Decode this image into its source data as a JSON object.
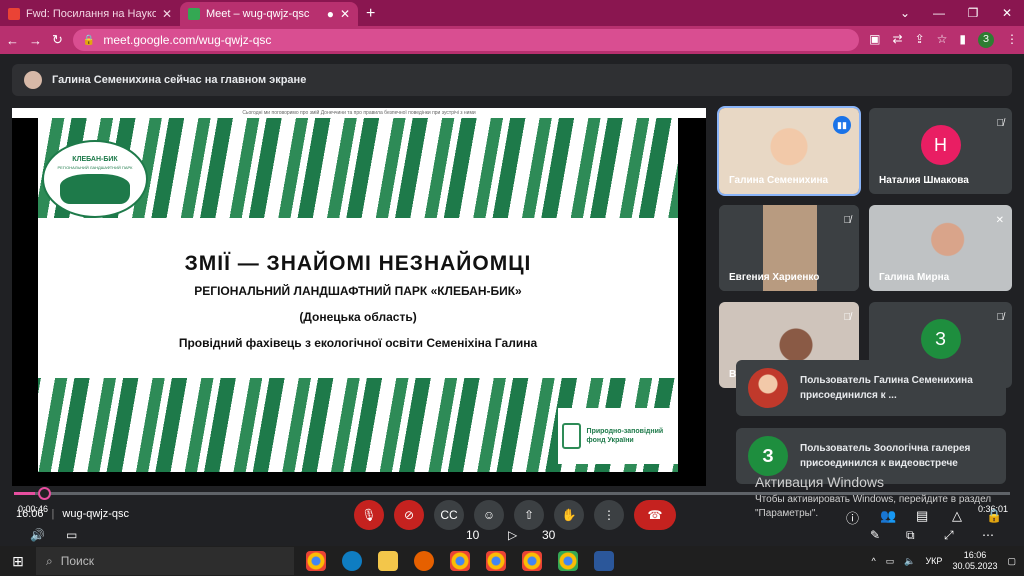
{
  "browser": {
    "tabs": [
      {
        "title": "Fwd: Посилання на Науковий п...",
        "active": false
      },
      {
        "title": "Meet – wug-qwjz-qsc",
        "active": true
      }
    ],
    "new_tab": "+",
    "url": "meet.google.com/wug-qwjz-qsc",
    "profile_initial": "З"
  },
  "meet": {
    "banner_text": "Галина Семенихина сейчас на главном экране",
    "meeting_code": "wug-qwjz-qsc",
    "clock": "16:06"
  },
  "slide": {
    "header_strip": "Сьогодні ми поговоримо про змій Донеччини та про правила безпечної поведінки при зустрічі з ними",
    "logo_title": "КЛЕБАН-БИК",
    "logo_sub": "РЕГІОНАЛЬНИЙ ЛАНДШАФТНИЙ ПАРК",
    "title": "ЗМІЇ — ЗНАЙОМІ НЕЗНАЙОМЦІ",
    "line1": "РЕГІОНАЛЬНИЙ ЛАНДШАФТНИЙ ПАРК «КЛЕБАН-БИК»",
    "line2": "(Донецька область)",
    "line3": "Провідний фахівець з екологічної освіти Семеніхіна Галина",
    "fund": "Природно-заповідний фонд України"
  },
  "participants": [
    {
      "name": "Галина Семенихина",
      "initial": "",
      "color": "",
      "speaking": true
    },
    {
      "name": "Наталия Шмакова",
      "initial": "Н",
      "color": "#e91e63",
      "speaking": false
    },
    {
      "name": "Евгения Хариенко",
      "initial": "",
      "color": "",
      "speaking": false
    },
    {
      "name": "Галина Мирна",
      "initial": "",
      "color": "",
      "speaking": false
    },
    {
      "name": "В",
      "initial": "",
      "color": "",
      "speaking": false
    },
    {
      "name": "",
      "initial": "З",
      "color": "#1e8e3e",
      "speaking": false
    }
  ],
  "toasts": [
    {
      "text": "Пользователь Галина Семенихина присоединился к ...",
      "initial": ""
    },
    {
      "text": "Пользователь Зоологічна галерея присоединился к видеовстрече",
      "initial": "З"
    }
  ],
  "player": {
    "elapsed": "0:00:46",
    "total": "0:36:01",
    "progress_fraction": 0.021,
    "rewind_label": "10",
    "forward_label": "30"
  },
  "activation": {
    "title": "Активация Windows",
    "subtitle": "Чтобы активировать Windows, перейдите в раздел \"Параметры\"."
  },
  "taskbar": {
    "search_placeholder": "Поиск",
    "lang": "УКР",
    "time": "16:06",
    "date": "30.05.2023"
  },
  "colors": {
    "tab_strip": "#8a1650",
    "toolbar": "#b8306f",
    "end_call": "#c5221f",
    "accent": "#e64fa0"
  }
}
